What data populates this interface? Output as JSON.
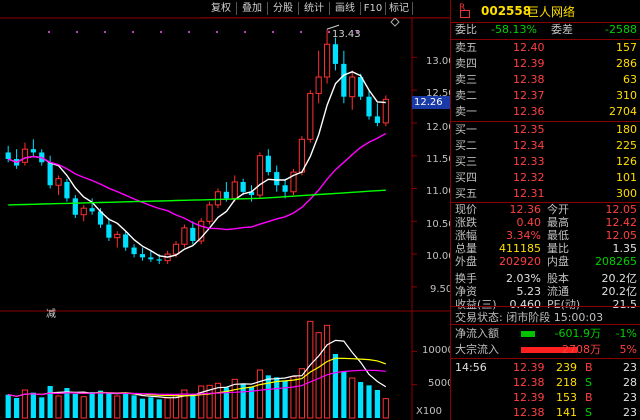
{
  "toolbar": {
    "buttons": [
      "复权",
      "叠加",
      "分股",
      "统计",
      "画线",
      "F10",
      "标记",
      "+自选",
      "返回"
    ],
    "diamond_icon": "diamond-icon"
  },
  "chart_data": [
    {
      "type": "candlestick",
      "title": "",
      "ylim": [
        9.3,
        13.6
      ],
      "y_ticks": [
        "13.00",
        "12.50",
        "12.00",
        "11.50",
        "11.00",
        "10.50",
        "10.00",
        "9.50"
      ],
      "current_price_tag": "12.26",
      "max_marker": "13.43",
      "mark_label": "减",
      "candles": [
        {
          "o": 11.55,
          "h": 11.65,
          "l": 11.4,
          "c": 11.45
        },
        {
          "o": 11.45,
          "h": 11.6,
          "l": 11.3,
          "c": 11.35
        },
        {
          "o": 11.4,
          "h": 11.7,
          "l": 11.35,
          "c": 11.6
        },
        {
          "o": 11.6,
          "h": 11.75,
          "l": 11.5,
          "c": 11.55
        },
        {
          "o": 11.55,
          "h": 11.6,
          "l": 11.35,
          "c": 11.4
        },
        {
          "o": 11.4,
          "h": 11.5,
          "l": 11.0,
          "c": 11.05
        },
        {
          "o": 11.05,
          "h": 11.2,
          "l": 10.9,
          "c": 11.15
        },
        {
          "o": 11.1,
          "h": 11.15,
          "l": 10.8,
          "c": 10.85
        },
        {
          "o": 10.85,
          "h": 10.9,
          "l": 10.55,
          "c": 10.6
        },
        {
          "o": 10.6,
          "h": 10.75,
          "l": 10.5,
          "c": 10.7
        },
        {
          "o": 10.7,
          "h": 10.85,
          "l": 10.6,
          "c": 10.65
        },
        {
          "o": 10.65,
          "h": 10.7,
          "l": 10.4,
          "c": 10.45
        },
        {
          "o": 10.45,
          "h": 10.55,
          "l": 10.2,
          "c": 10.25
        },
        {
          "o": 10.25,
          "h": 10.35,
          "l": 10.1,
          "c": 10.3
        },
        {
          "o": 10.3,
          "h": 10.35,
          "l": 10.05,
          "c": 10.1
        },
        {
          "o": 10.1,
          "h": 10.15,
          "l": 9.95,
          "c": 10.0
        },
        {
          "o": 10.0,
          "h": 10.1,
          "l": 9.9,
          "c": 9.95
        },
        {
          "o": 9.95,
          "h": 10.05,
          "l": 9.88,
          "c": 9.92
        },
        {
          "o": 9.92,
          "h": 10.0,
          "l": 9.85,
          "c": 9.9
        },
        {
          "o": 9.9,
          "h": 10.05,
          "l": 9.85,
          "c": 10.0
        },
        {
          "o": 10.0,
          "h": 10.2,
          "l": 9.95,
          "c": 10.15
        },
        {
          "o": 10.15,
          "h": 10.45,
          "l": 10.1,
          "c": 10.4
        },
        {
          "o": 10.4,
          "h": 10.5,
          "l": 10.15,
          "c": 10.2
        },
        {
          "o": 10.2,
          "h": 10.55,
          "l": 10.15,
          "c": 10.5
        },
        {
          "o": 10.5,
          "h": 10.8,
          "l": 10.45,
          "c": 10.75
        },
        {
          "o": 10.75,
          "h": 11.0,
          "l": 10.7,
          "c": 10.95
        },
        {
          "o": 10.95,
          "h": 11.1,
          "l": 10.8,
          "c": 10.85
        },
        {
          "o": 10.85,
          "h": 11.2,
          "l": 10.8,
          "c": 11.1
        },
        {
          "o": 11.1,
          "h": 11.15,
          "l": 10.9,
          "c": 10.95
        },
        {
          "o": 10.95,
          "h": 11.05,
          "l": 10.8,
          "c": 10.9
        },
        {
          "o": 10.9,
          "h": 11.55,
          "l": 10.85,
          "c": 11.5
        },
        {
          "o": 11.5,
          "h": 11.6,
          "l": 11.2,
          "c": 11.25
        },
        {
          "o": 11.25,
          "h": 11.35,
          "l": 10.95,
          "c": 11.05
        },
        {
          "o": 11.05,
          "h": 11.15,
          "l": 10.85,
          "c": 10.95
        },
        {
          "o": 10.95,
          "h": 11.3,
          "l": 10.9,
          "c": 11.25
        },
        {
          "o": 11.25,
          "h": 11.8,
          "l": 11.2,
          "c": 11.75
        },
        {
          "o": 11.75,
          "h": 12.5,
          "l": 11.7,
          "c": 12.45
        },
        {
          "o": 12.45,
          "h": 13.1,
          "l": 12.3,
          "c": 12.7
        },
        {
          "o": 12.7,
          "h": 13.43,
          "l": 12.6,
          "c": 13.2
        },
        {
          "o": 13.2,
          "h": 13.3,
          "l": 12.8,
          "c": 12.9
        },
        {
          "o": 12.9,
          "h": 13.1,
          "l": 12.3,
          "c": 12.4
        },
        {
          "o": 12.4,
          "h": 12.8,
          "l": 12.2,
          "c": 12.7
        },
        {
          "o": 12.7,
          "h": 12.75,
          "l": 12.35,
          "c": 12.4
        },
        {
          "o": 12.4,
          "h": 12.5,
          "l": 12.05,
          "c": 12.1
        },
        {
          "o": 12.1,
          "h": 12.3,
          "l": 11.95,
          "c": 12.0
        },
        {
          "o": 12.0,
          "h": 12.42,
          "l": 11.95,
          "c": 12.36
        }
      ],
      "ma5_color": "#ffffff",
      "ma10_color": "#ffff00",
      "ma20_color": "#ff00ff",
      "ma60_color": "#00ff00"
    },
    {
      "type": "bar",
      "title": "",
      "ylim": [
        0,
        15000
      ],
      "y_ticks": [
        "10000",
        "5000"
      ],
      "unit": "X100",
      "volumes": [
        3500,
        3000,
        4200,
        3800,
        3100,
        4800,
        3300,
        4500,
        3600,
        3200,
        3900,
        4100,
        3700,
        3300,
        3600,
        3400,
        2900,
        3100,
        2800,
        3000,
        3500,
        4200,
        3600,
        4800,
        4900,
        5200,
        4600,
        5800,
        5100,
        4700,
        7200,
        6400,
        6100,
        5600,
        6200,
        7400,
        14500,
        12800,
        13900,
        9600,
        6900,
        6000,
        5400,
        4900,
        4200,
        2900
      ]
    }
  ],
  "quote": {
    "code": "002558",
    "name": "巨人网络",
    "r_icon": "r-icon",
    "weibi_label": "委比",
    "weibi": "-58.13%",
    "weicha_label": "委差",
    "weicha": "-2588",
    "asks": [
      {
        "label": "卖五",
        "price": "12.40",
        "vol": "157"
      },
      {
        "label": "卖四",
        "price": "12.39",
        "vol": "286"
      },
      {
        "label": "卖三",
        "price": "12.38",
        "vol": "63"
      },
      {
        "label": "卖二",
        "price": "12.37",
        "vol": "310"
      },
      {
        "label": "卖一",
        "price": "12.36",
        "vol": "2704"
      }
    ],
    "bids": [
      {
        "label": "买一",
        "price": "12.35",
        "vol": "180"
      },
      {
        "label": "买二",
        "price": "12.34",
        "vol": "225"
      },
      {
        "label": "买三",
        "price": "12.33",
        "vol": "126"
      },
      {
        "label": "买四",
        "price": "12.32",
        "vol": "101"
      },
      {
        "label": "买五",
        "price": "12.31",
        "vol": "300"
      }
    ],
    "stats": [
      {
        "l1": "现价",
        "v1": "12.36",
        "l2": "今开",
        "v2": "12.05"
      },
      {
        "l1": "涨跌",
        "v1": "0.40",
        "l2": "最高",
        "v2": "12.42"
      },
      {
        "l1": "涨幅",
        "v1": "3.34%",
        "l2": "最低",
        "v2": "12.05"
      },
      {
        "l1": "总量",
        "v1": "411185",
        "l2": "量比",
        "v2": "1.35"
      },
      {
        "l1": "外盘",
        "v1": "202920",
        "l2": "内盘",
        "v2": "208265"
      },
      {
        "l1": "换手",
        "v1": "2.03%",
        "l2": "股本",
        "v2": "20.2亿"
      },
      {
        "l1": "净资",
        "v1": "5.23",
        "l2": "流通",
        "v2": "20.2亿"
      },
      {
        "l1": "收益(三)",
        "v1": "0.460",
        "l2": "PE(动)",
        "v2": "21.5"
      }
    ],
    "trade_state_label": "交易状态:",
    "trade_state": "闭市阶段",
    "trade_time": "15:00:03",
    "flows": [
      {
        "label": "净流入额",
        "value": "-601.9万",
        "pct": "-1%",
        "color": "#00c000"
      },
      {
        "label": "大宗流入",
        "value": "2708万",
        "pct": "5%",
        "color": "#ff2020"
      }
    ],
    "ticks": [
      {
        "time": "14:56",
        "price": "12.39",
        "vol": "239",
        "bs": "B",
        "n": "23"
      },
      {
        "time": "",
        "price": "12.38",
        "vol": "218",
        "bs": "S",
        "n": "28"
      },
      {
        "time": "",
        "price": "12.39",
        "vol": "153",
        "bs": "B",
        "n": "23"
      },
      {
        "time": "",
        "price": "12.38",
        "vol": "141",
        "bs": "S",
        "n": "23"
      }
    ]
  }
}
